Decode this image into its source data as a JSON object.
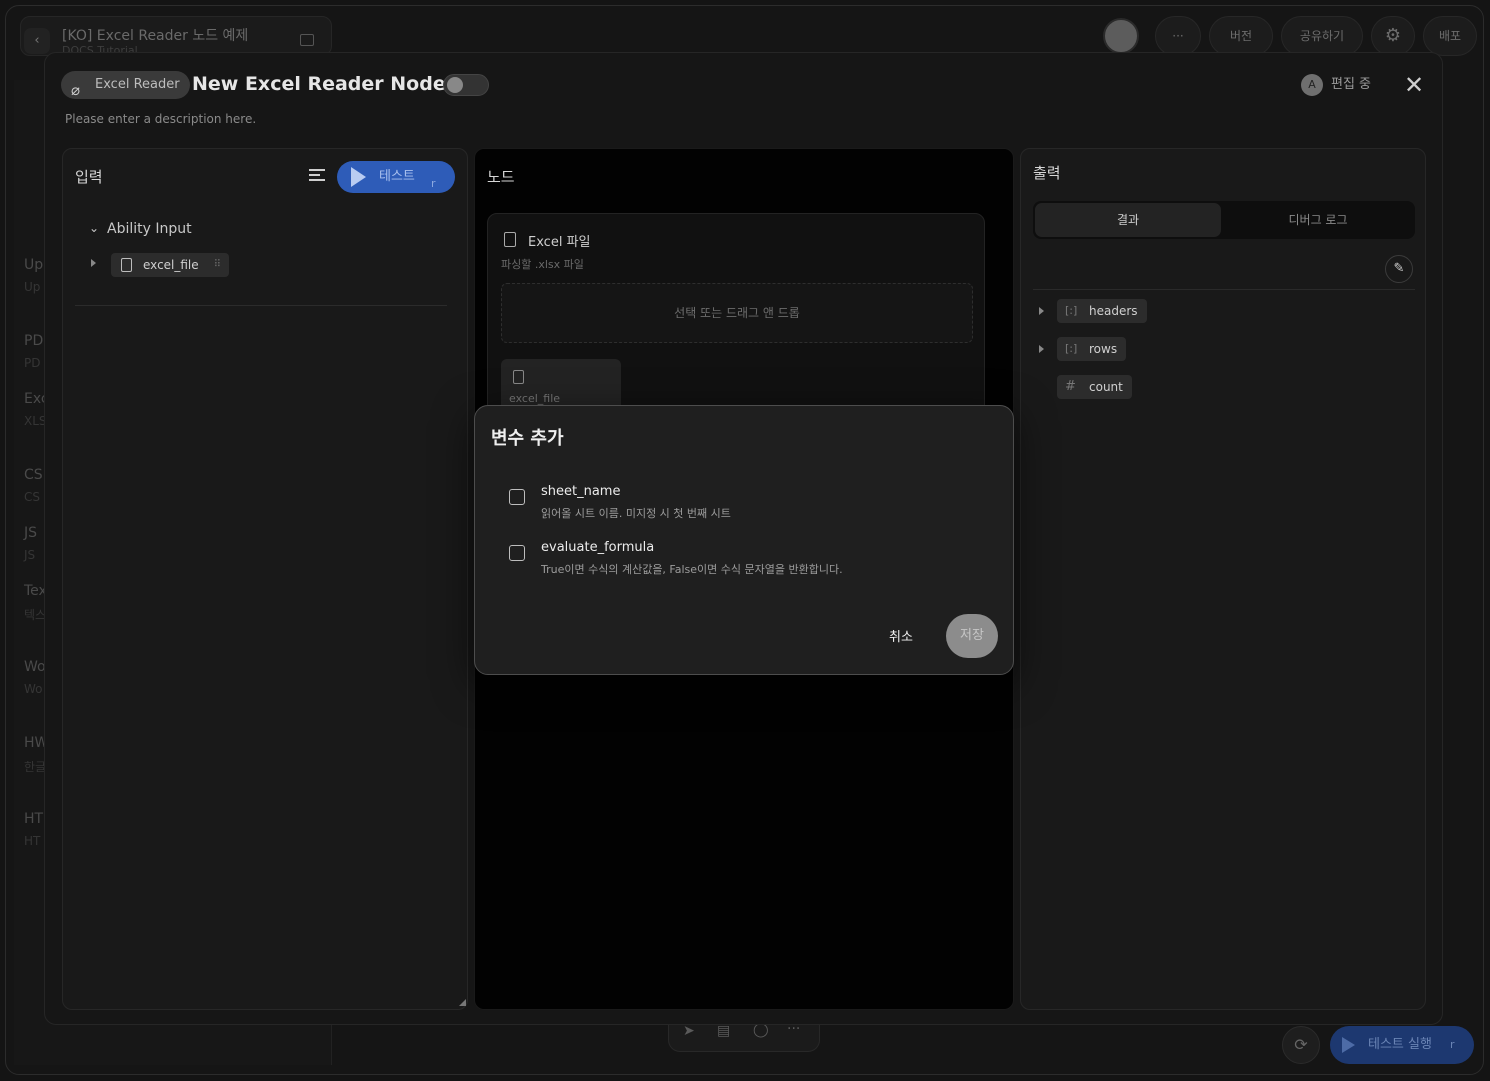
{
  "background": {
    "title": "[KO] Excel Reader 노드 예제",
    "subtitle": "DOCS Tutorial",
    "toolbar": [
      "···",
      "버전",
      "공유하기",
      "배포"
    ],
    "sidebar": [
      {
        "title": "Up",
        "sub": "Up"
      },
      {
        "title": "PD",
        "sub": "PD"
      },
      {
        "title": "Exc",
        "sub": "XLS"
      },
      {
        "title": "CS",
        "sub": "CS"
      },
      {
        "title": "JS",
        "sub": "JS"
      },
      {
        "title": "Tex",
        "sub": "텍스"
      },
      {
        "title": "Wo",
        "sub": "Wo"
      },
      {
        "title": "HW",
        "sub": "한글"
      },
      {
        "title": "HT",
        "sub": "HT"
      }
    ],
    "run_label": "테스트 실행",
    "run_key": "r"
  },
  "node": {
    "type_badge": "Excel Reader",
    "title": "New Excel Reader Node 1",
    "description": "Please enter a description here.",
    "editing_avatar": "A",
    "editing_status": "편집 중"
  },
  "input_panel": {
    "title": "입력",
    "test_label": "테스트",
    "test_key": "r",
    "group": "Ability Input",
    "item": "excel_file"
  },
  "node_panel": {
    "title": "노드",
    "field_label": "Excel 파일",
    "field_hint": "파싱할 .xlsx 파일",
    "dropzone": "선택 또는 드래그 앤 드롭",
    "chip_name": "excel_file"
  },
  "output_panel": {
    "title": "출력",
    "tab_result": "결과",
    "tab_debug": "디버그 로그",
    "fields": [
      {
        "name": "headers",
        "icon": "[:]"
      },
      {
        "name": "rows",
        "icon": "[:]"
      },
      {
        "name": "count",
        "icon": "#"
      }
    ]
  },
  "dialog": {
    "title": "변수 추가",
    "options": [
      {
        "name": "sheet_name",
        "desc": "읽어올 시트 이름. 미지정 시 첫 번째 시트"
      },
      {
        "name": "evaluate_formula",
        "desc": "True이면 수식의 계산값을, False이면 수식 문자열을 반환합니다."
      }
    ],
    "cancel": "취소",
    "save": "저장"
  }
}
